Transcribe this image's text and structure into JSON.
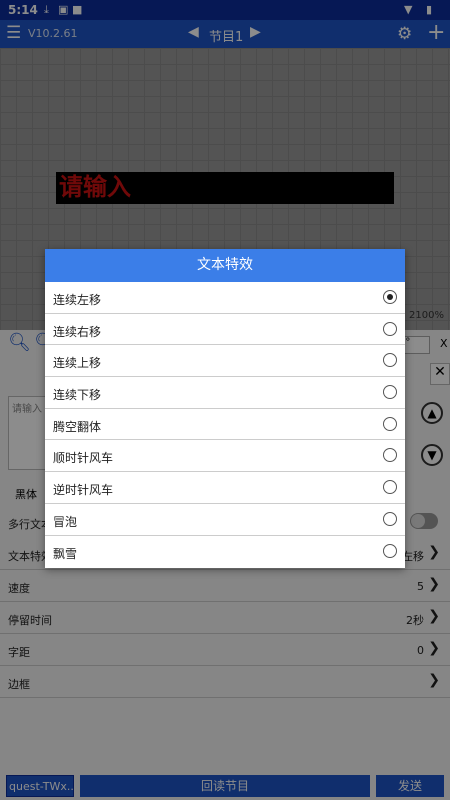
{
  "status_bar": {
    "time": "5:14",
    "icons": [
      "download-icon",
      "image-icon",
      "square-icon",
      "wifi-icon",
      "battery-icon"
    ]
  },
  "app_bar": {
    "version": "V10.2.61",
    "program_title": "节目1"
  },
  "canvas": {
    "led_text": "请输入",
    "zoom": "2100%"
  },
  "panel": {
    "angle_value": "0°",
    "x_label": "X",
    "text_placeholder": "请输入",
    "font_name": "黑体",
    "multiline_label": "多行文本",
    "settings": [
      {
        "label": "文本特效",
        "value": "左移"
      },
      {
        "label": "速度",
        "value": "5"
      },
      {
        "label": "停留时间",
        "value": "2秒"
      },
      {
        "label": "字距",
        "value": "0"
      },
      {
        "label": "边框",
        "value": ""
      }
    ]
  },
  "bottom_bar": {
    "name_input": "quest-TWx...",
    "readback": "回读节目",
    "send": "发送"
  },
  "dialog": {
    "title": "文本特效",
    "options": [
      {
        "label": "连续左移",
        "checked": true
      },
      {
        "label": "连续右移",
        "checked": false
      },
      {
        "label": "连续上移",
        "checked": false
      },
      {
        "label": "连续下移",
        "checked": false
      },
      {
        "label": "腾空翻体",
        "checked": false
      },
      {
        "label": "顺时针风车",
        "checked": false
      },
      {
        "label": "逆时针风车",
        "checked": false
      },
      {
        "label": "冒泡",
        "checked": false
      },
      {
        "label": "飘雪",
        "checked": false
      }
    ]
  },
  "colors": {
    "primary": "#1e55c7",
    "status_bar": "#0b2d9c",
    "dialog_header": "#3b7ee8",
    "led_text": "#cc1111"
  }
}
